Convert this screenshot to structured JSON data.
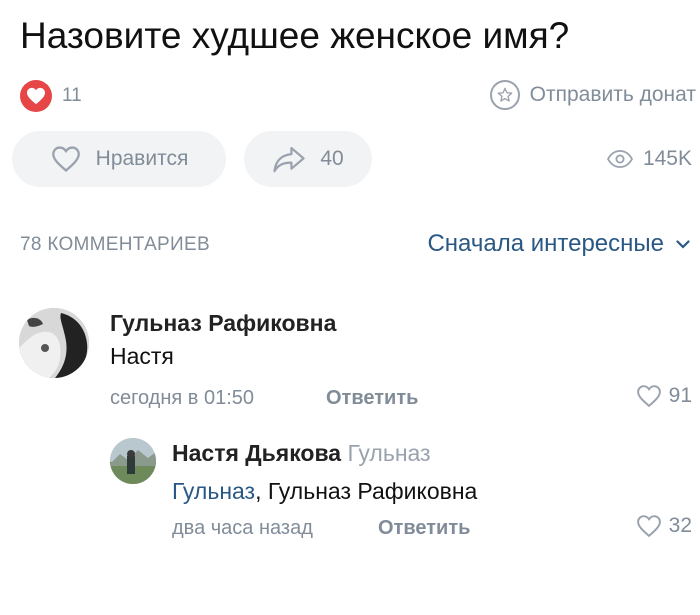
{
  "post": {
    "title": "Назовите худшее женское имя?",
    "likes_count": "11",
    "donate_label": "Отправить донат",
    "like_button_label": "Нравится",
    "share_count": "40",
    "views_count": "145K"
  },
  "comments_header": {
    "count_label": "78 КОММЕНТАРИЕВ",
    "sort_label": "Сначала интересные"
  },
  "comments": [
    {
      "author": "Гульназ Рафиковна",
      "text": "Настя",
      "time": "сегодня в 01:50",
      "reply_label": "Ответить",
      "likes": "91"
    },
    {
      "author": "Настя Дьякова",
      "reply_to": "Гульназ",
      "mention": "Гульназ",
      "text_rest": ", Гульназ Рафиковна",
      "time": "два часа назад",
      "reply_label": "Ответить",
      "likes": "32"
    }
  ],
  "colors": {
    "accent": "#2a5885",
    "like_red": "#e64646",
    "muted": "#818c99",
    "pill_bg": "#f2f3f5"
  },
  "icons": [
    "heart-icon",
    "star-icon",
    "share-arrow-icon",
    "eye-icon",
    "chevron-down-icon"
  ]
}
